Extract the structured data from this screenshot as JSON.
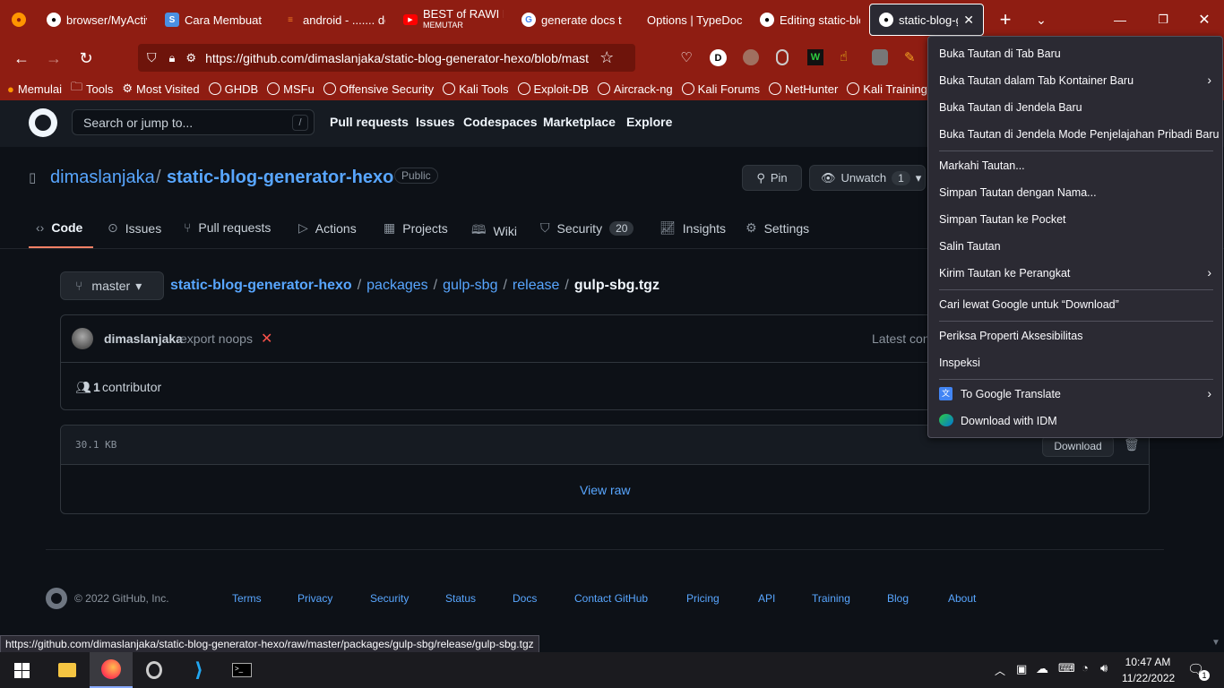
{
  "browser": {
    "tabs": [
      {
        "title": "browser/MyActiv",
        "icon": "github-icon"
      },
      {
        "title": "Cara Membuat S",
        "icon": "s-icon"
      },
      {
        "title": "android - ....... do",
        "icon": "stackoverflow-icon"
      },
      {
        "title": "BEST of RAWI BE",
        "subtitle": "MEMUTAR",
        "icon": "youtube-icon"
      },
      {
        "title": "generate docs ty",
        "icon": "google-icon"
      },
      {
        "title": "Options | TypeDoc",
        "icon": "none"
      },
      {
        "title": "Editing static-blo",
        "icon": "github-icon"
      },
      {
        "title": "static-blog-ge",
        "icon": "github-icon"
      }
    ],
    "url": "https://github.com/dimaslanjaka/static-blog-generator-hexo/blob/mast",
    "bookmarks": [
      "Memulai",
      "Tools",
      "Most Visited",
      "GHDB",
      "MSFu",
      "Offensive Security",
      "Kali Tools",
      "Exploit-DB",
      "Aircrack-ng",
      "Kali Forums",
      "NetHunter",
      "Kali Training"
    ],
    "profile_letter": "D"
  },
  "github": {
    "search_placeholder": "Search or jump to...",
    "search_key": "/",
    "nav": [
      "Pull requests",
      "Issues",
      "Codespaces",
      "Marketplace",
      "Explore"
    ],
    "owner": "dimaslanjaka",
    "repo": "static-blog-generator-hexo",
    "visibility": "Public",
    "pin_label": "Pin",
    "unwatch_label": "Unwatch",
    "watch_count": "1",
    "tabs": [
      {
        "label": "Code"
      },
      {
        "label": "Issues"
      },
      {
        "label": "Pull requests"
      },
      {
        "label": "Actions"
      },
      {
        "label": "Projects"
      },
      {
        "label": "Wiki"
      },
      {
        "label": "Security",
        "count": "20"
      },
      {
        "label": "Insights"
      },
      {
        "label": "Settings"
      }
    ],
    "branch": "master",
    "path": [
      "static-blog-generator-hexo",
      "packages",
      "gulp-sbg",
      "release"
    ],
    "file": "gulp-sbg.tgz",
    "commit_author": "dimaslanjaka",
    "commit_msg": "export noops",
    "latest_commit": "Latest con",
    "contributors_count": "1",
    "contributors_label": "contributor",
    "file_size": "30.1 KB",
    "download_label": "Download",
    "view_raw": "View raw",
    "copyright": "© 2022 GitHub, Inc.",
    "footer_links": [
      "Terms",
      "Privacy",
      "Security",
      "Status",
      "Docs",
      "Contact GitHub",
      "Pricing",
      "API",
      "Training",
      "Blog",
      "About"
    ]
  },
  "context_menu": {
    "items": [
      "Buka Tautan di Tab Baru",
      "Buka Tautan dalam Tab Kontainer Baru",
      "Buka Tautan di Jendela Baru",
      "Buka Tautan di Jendela Mode Penjelajahan Pribadi Baru",
      "Markahi Tautan...",
      "Simpan Tautan dengan Nama...",
      "Simpan Tautan ke Pocket",
      "Salin Tautan",
      "Kirim Tautan ke Perangkat",
      "Cari lewat Google untuk “Download”",
      "Periksa Properti Aksesibilitas",
      "Inspeksi",
      "To Google Translate",
      "Download with IDM"
    ]
  },
  "status_url": "https://github.com/dimaslanjaka/static-blog-generator-hexo/raw/master/packages/gulp-sbg/release/gulp-sbg.tgz",
  "taskbar": {
    "time": "10:47 AM",
    "date": "11/22/2022",
    "notification_count": "1"
  }
}
